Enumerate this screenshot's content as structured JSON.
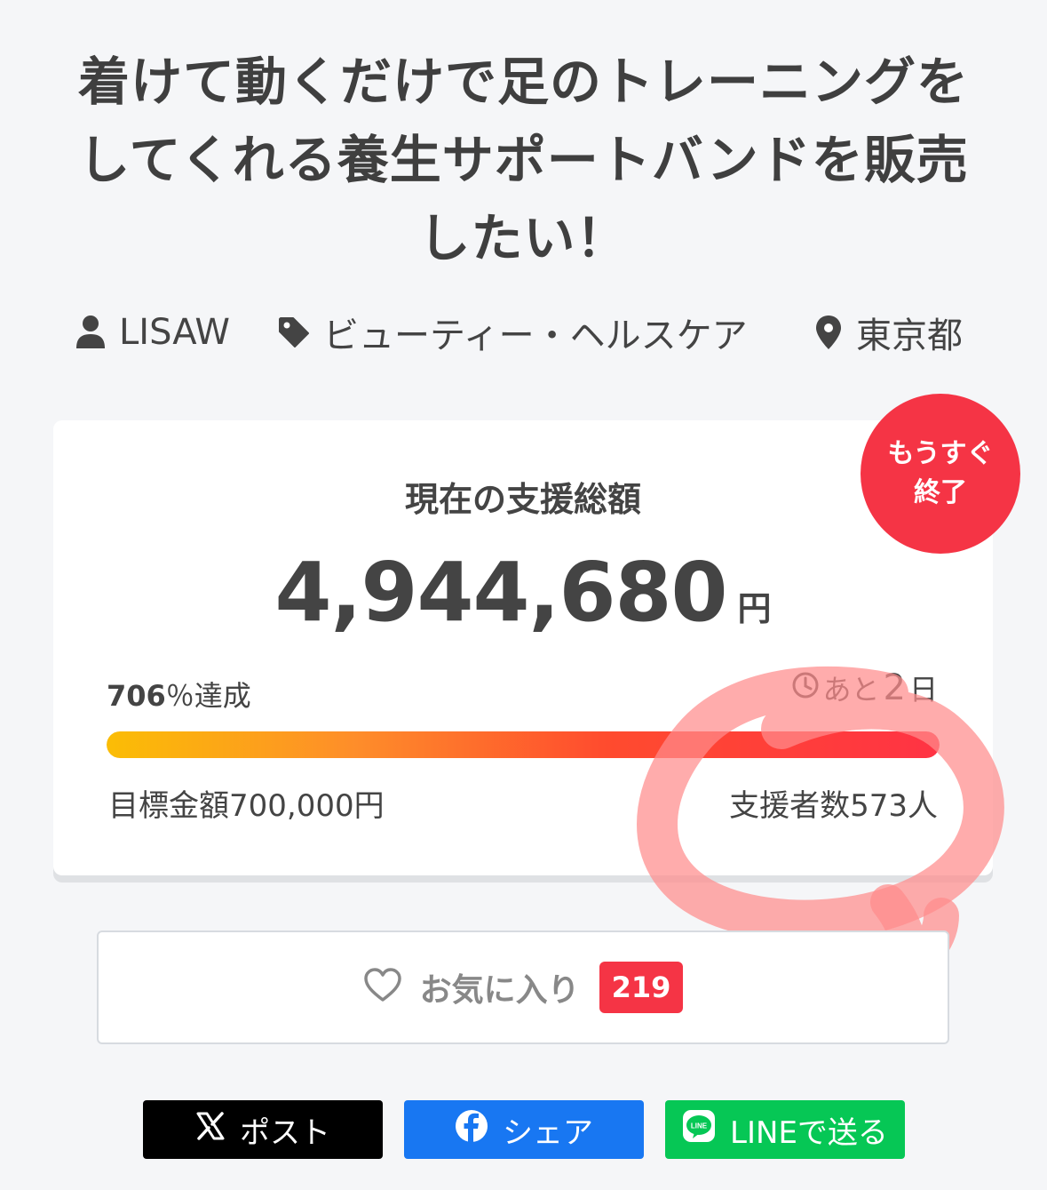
{
  "project": {
    "title_lines": [
      "着けて動くだけで足のトレーニングを",
      "してくれる養生サポートバンドを販売",
      "したい！"
    ],
    "owner": "LISAW",
    "category": "ビューティー・ヘルスケア",
    "location": "東京都"
  },
  "funding": {
    "label": "現在の支援総額",
    "amount": "4,944,680",
    "currency": "円",
    "percent": "706",
    "percent_suffix": "％達成",
    "progress_fraction": 1.0,
    "days_prefix": "あと",
    "days_left": "2",
    "days_suffix": "日",
    "goal_text": "目標金額700,000円",
    "backers_text": "支援者数573人",
    "ending_badge_lines": [
      "もうすぐ",
      "終了"
    ]
  },
  "favorite": {
    "label": "お気に入り",
    "count": "219"
  },
  "share": {
    "x_label": "ポスト",
    "facebook_label": "シェア",
    "line_label": "LINEで送る",
    "line_icon_text": "LINE"
  },
  "colors": {
    "accent_red": "#f53445",
    "x_black": "#000000",
    "facebook_blue": "#1877f2",
    "line_green": "#06c755",
    "progress_start": "#fbbd05",
    "progress_end": "#ff3344",
    "annotation_marker": "#ff8c8c"
  },
  "icons": {
    "owner": "person-icon",
    "category": "tag-icon",
    "location": "map-pin-icon",
    "days": "clock-icon",
    "favorite": "heart-outline-icon",
    "x": "x-logo-icon",
    "facebook": "facebook-logo-icon",
    "line": "line-logo-icon"
  }
}
